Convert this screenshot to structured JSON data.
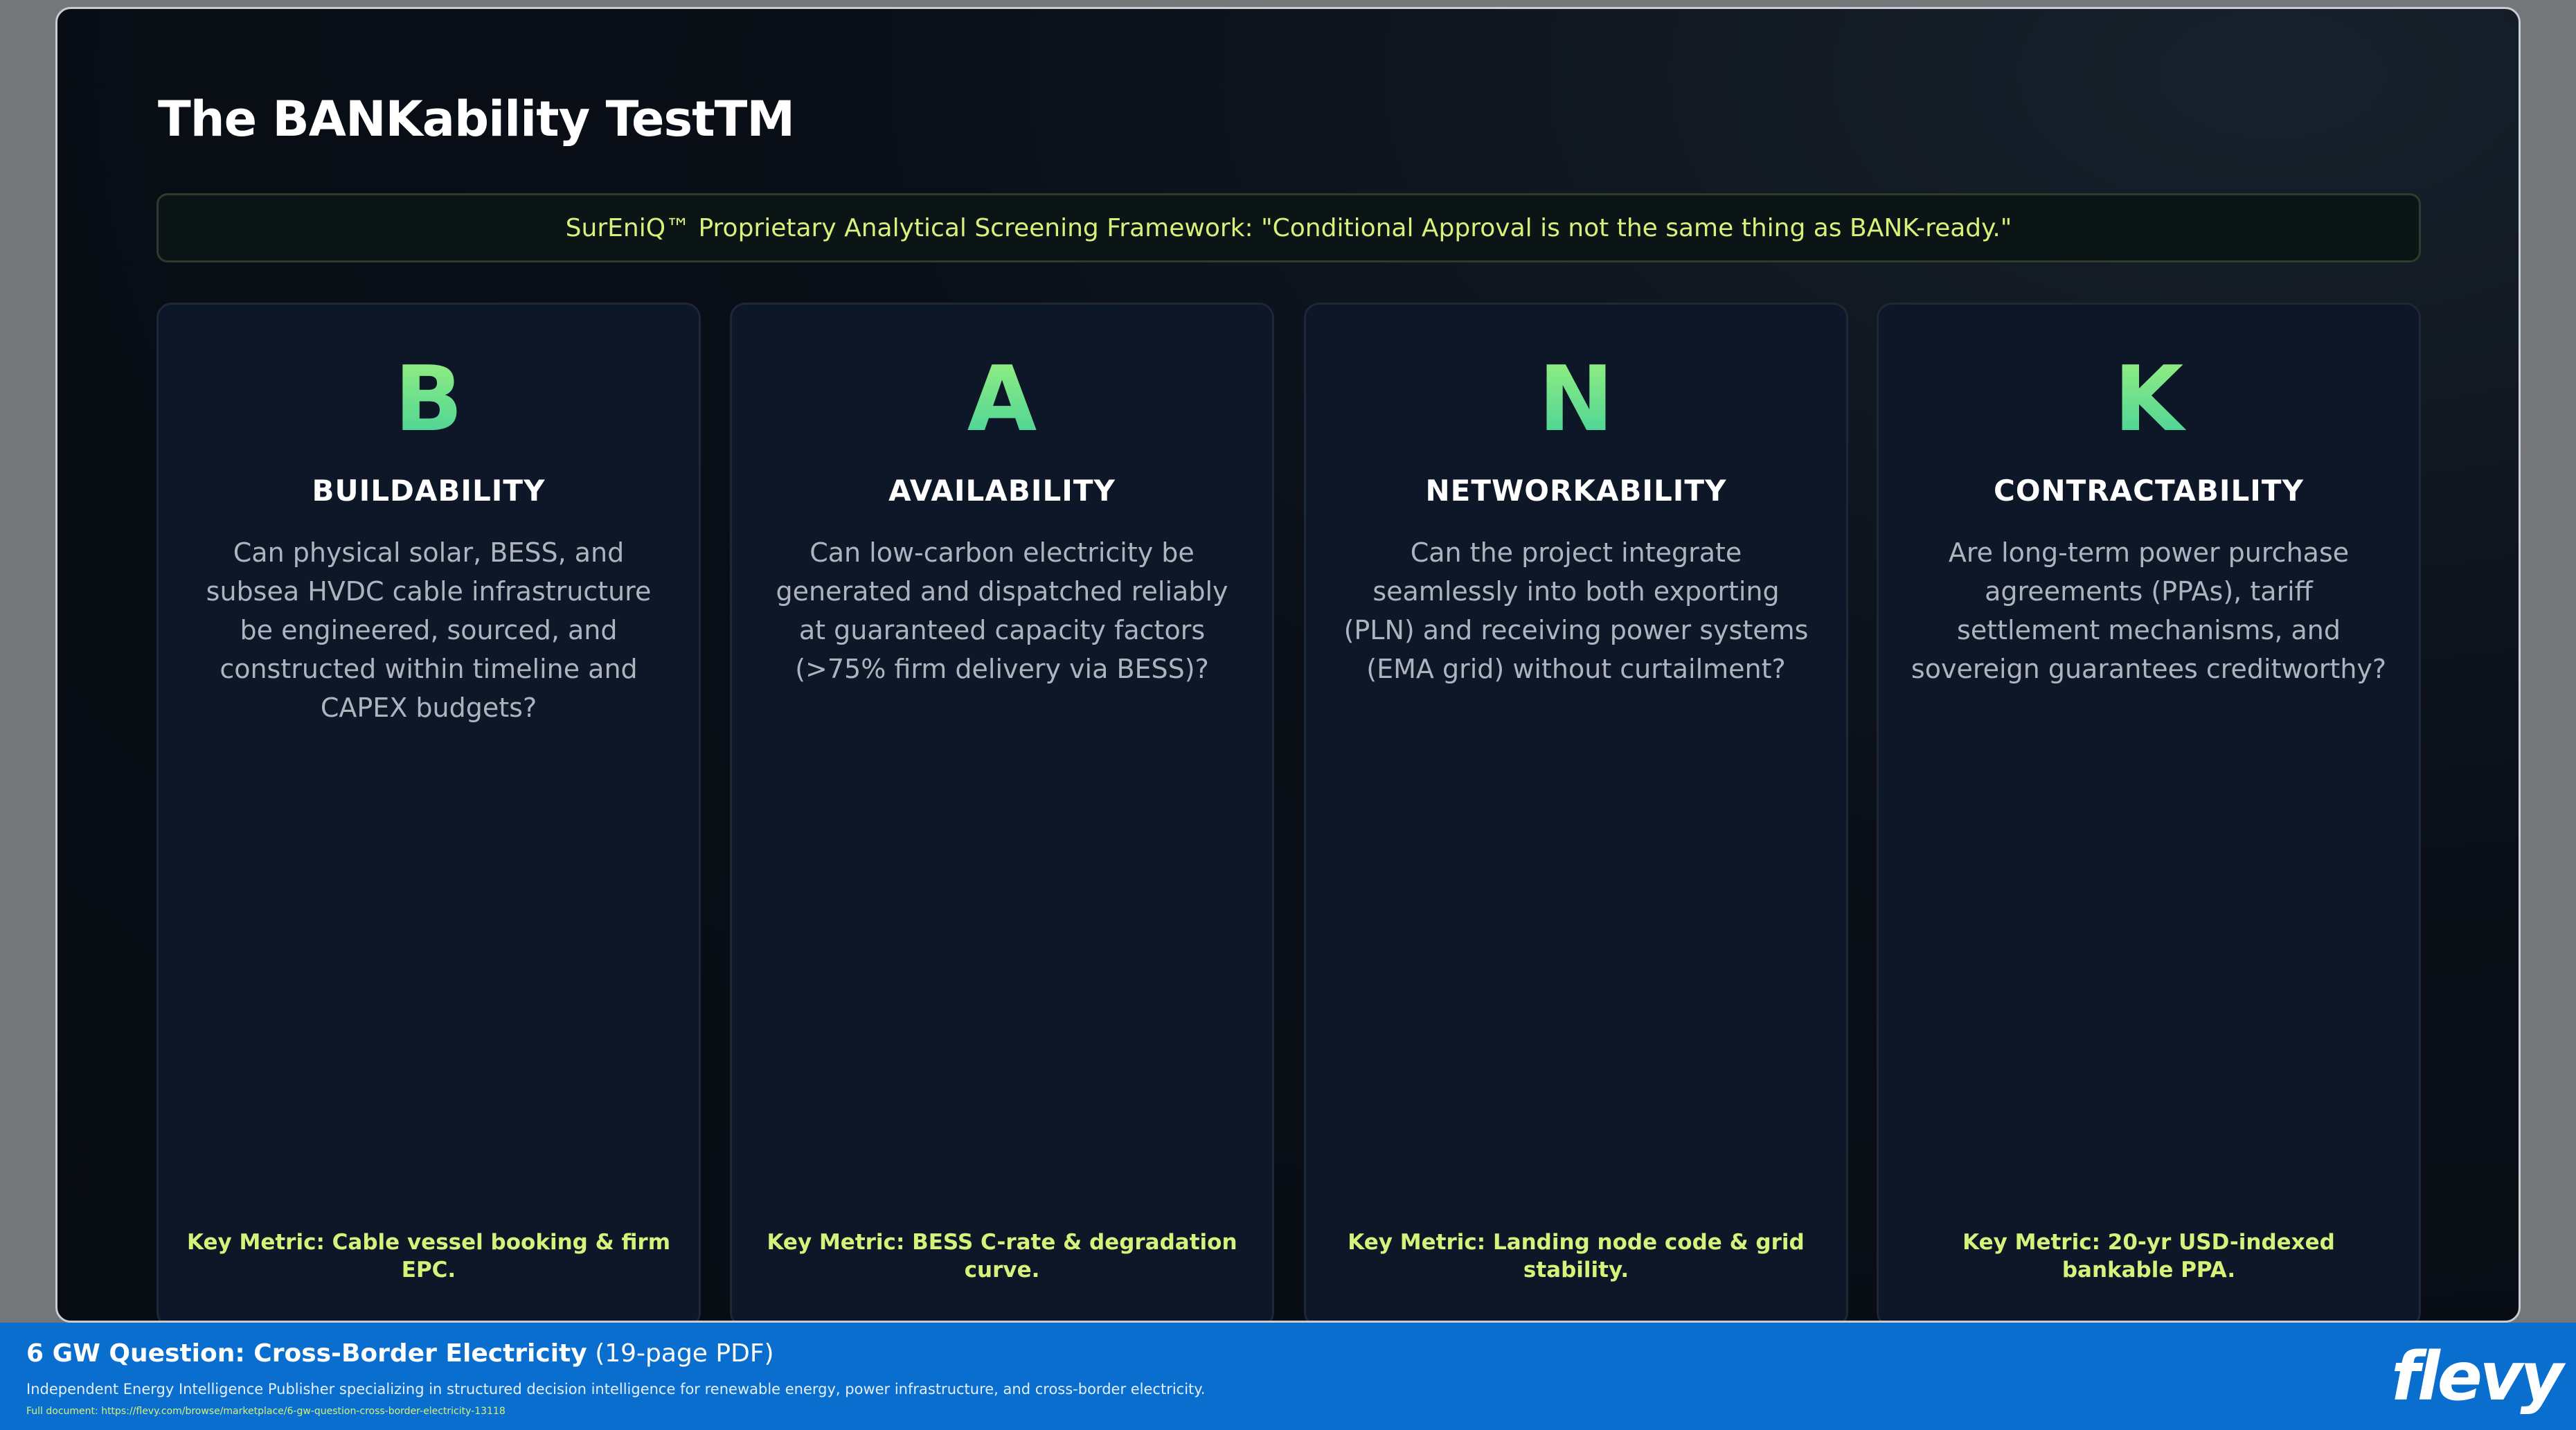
{
  "slide": {
    "title": "The BANKability TestTM",
    "banner": "SurEniQ™ Proprietary Analytical Screening Framework: \"Conditional Approval is not the same thing as BANK-ready.\"",
    "cards": [
      {
        "letter": "B",
        "name": "BUILDABILITY",
        "description": "Can physical solar, BESS, and subsea HVDC cable infrastructure be engineered, sourced, and constructed within timeline and CAPEX budgets?",
        "metric": "Key Metric: Cable vessel booking & firm EPC."
      },
      {
        "letter": "A",
        "name": "AVAILABILITY",
        "description": "Can low-carbon electricity be generated and dispatched reliably at guaranteed capacity factors (>75% firm delivery via BESS)?",
        "metric": "Key Metric: BESS C-rate & degradation curve."
      },
      {
        "letter": "N",
        "name": "NETWORKABILITY",
        "description": "Can the project integrate seamlessly into both exporting (PLN) and receiving power systems (EMA grid) without curtailment?",
        "metric": "Key Metric: Landing node code & grid stability."
      },
      {
        "letter": "K",
        "name": "CONTRACTABILITY",
        "description": "Are long-term power purchase agreements (PPAs), tariff settlement mechanisms, and sovereign guarantees creditworthy?",
        "metric": "Key Metric: 20-yr USD-indexed bankable PPA."
      }
    ]
  },
  "footer": {
    "title": "6 GW Question: Cross-Border Electricity",
    "pages": "(19-page PDF)",
    "subtitle": "Independent Energy Intelligence Publisher specializing in structured decision intelligence for renewable energy, power infrastructure, and cross-border electricity.",
    "link": "Full document: https://flevy.com/browse/marketplace/6-gw-question-cross-border-electricity-13118",
    "logo": "flevy"
  },
  "colors": {
    "accent": "#d6f27a",
    "letter_gradient_top": "#9df27c",
    "letter_gradient_bottom": "#3fcf9d",
    "footer_bg": "#0a6ecf",
    "card_bg": "#0e1728"
  }
}
